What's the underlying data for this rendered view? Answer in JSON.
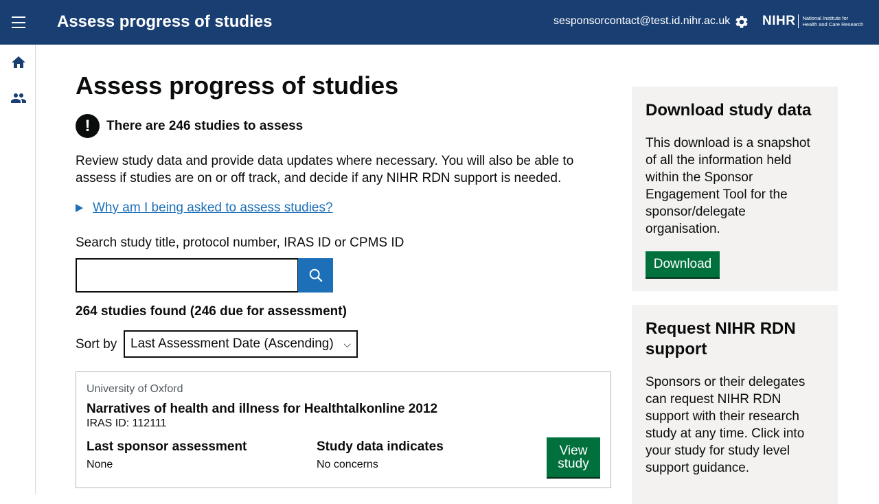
{
  "header": {
    "title": "Assess progress of studies",
    "user_email": "sesponsorcontact@test.id.nihr.ac.uk",
    "logo_main": "NIHR",
    "logo_sub_line1": "National Institute for",
    "logo_sub_line2": "Health and Care Research",
    "background_color": "#193e72"
  },
  "siderail": {
    "items": [
      {
        "icon": "home-icon"
      },
      {
        "icon": "users-icon"
      }
    ]
  },
  "main": {
    "page_title": "Assess progress of studies",
    "warning_icon_text": "!",
    "warning_text": "There are 246 studies to assess",
    "intro": "Review study data and provide data updates where necessary. You will also be able to assess if studies are on or off track, and decide if any NIHR RDN support is needed.",
    "details_link": "Why am I being asked to assess studies?",
    "search_label": "Search study title, protocol number, IRAS ID or CPMS ID",
    "search_value": "",
    "results_count": "264 studies found (246 due for assessment)",
    "sort_label": "Sort by",
    "sort_selected": "Last Assessment Date (Ascending)"
  },
  "study_card": {
    "organisation": "University of Oxford",
    "title": "Narratives of health and illness for Healthtalkonline 2012",
    "iras_id": "IRAS ID: 112111",
    "last_assessment_label": "Last sponsor assessment",
    "last_assessment_value": "None",
    "data_indicates_label": "Study data indicates",
    "data_indicates_value": "No concerns",
    "view_button_line1": "View",
    "view_button_line2": "study"
  },
  "download_panel": {
    "title": "Download study data",
    "body": "This download is a snapshot of all the information held within the Sponsor Engagement Tool for the sponsor/delegate organisation.",
    "button": "Download"
  },
  "support_panel": {
    "title": "Request NIHR RDN support",
    "body": "Sponsors or their delegates can request NIHR RDN support with their research study at any time. Click into your study for study level support guidance."
  },
  "colors": {
    "link": "#1d70b8",
    "primary_button": "#00703c",
    "panel_background": "#f3f2f1"
  }
}
